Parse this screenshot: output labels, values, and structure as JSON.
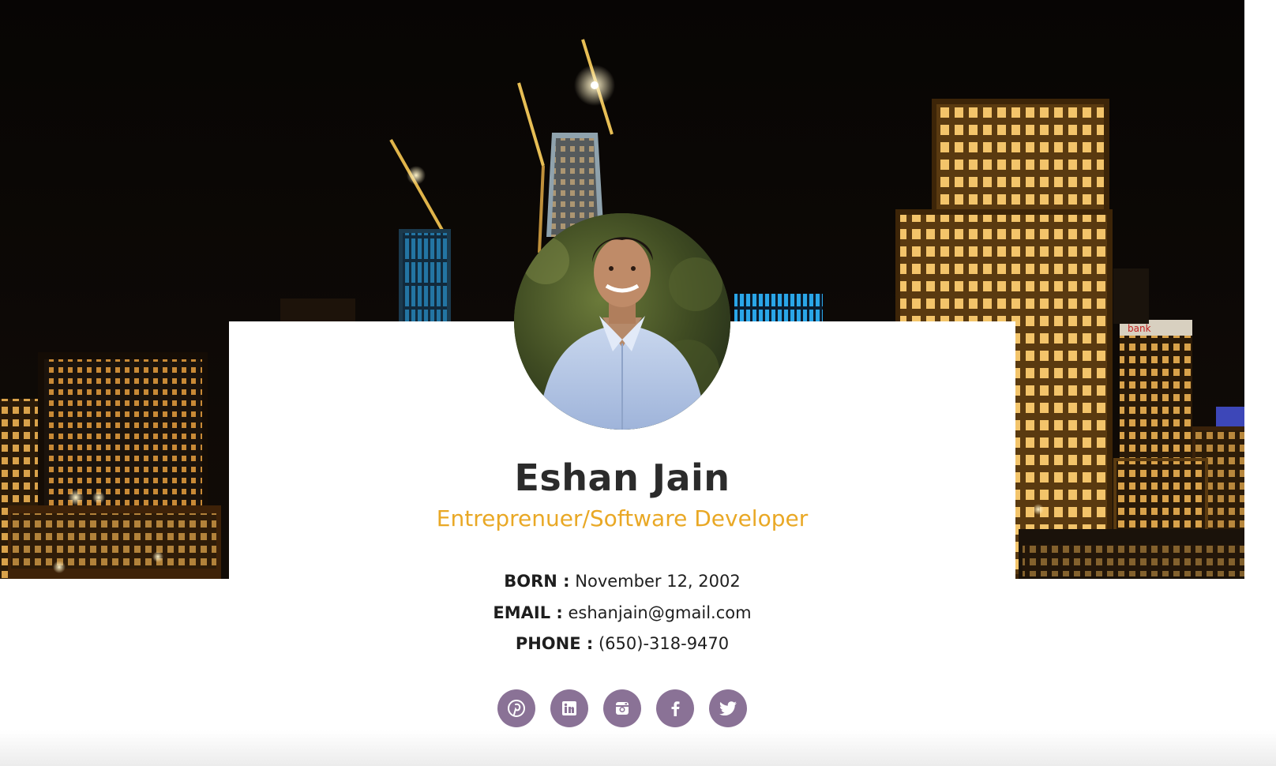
{
  "profile": {
    "name": "Eshan Jain",
    "title": "Entreprenuer/Software Developer",
    "born_label": "BORN :",
    "born_value": "November 12, 2002",
    "email_label": "EMAIL :",
    "email_value": "eshanjain@gmail.com",
    "phone_label": "PHONE :",
    "phone_value": "(650)-318-9470"
  },
  "hero": {
    "building_sign": "bank"
  },
  "socials": [
    {
      "name": "pinterest",
      "icon": "pinterest-icon"
    },
    {
      "name": "linkedin",
      "icon": "linkedin-icon"
    },
    {
      "name": "instagram",
      "icon": "instagram-icon"
    },
    {
      "name": "facebook",
      "icon": "facebook-icon"
    },
    {
      "name": "twitter",
      "icon": "twitter-icon"
    }
  ],
  "colors": {
    "accent": "#e9a825",
    "social": "#8a7296",
    "name": "#2b2b2b"
  }
}
